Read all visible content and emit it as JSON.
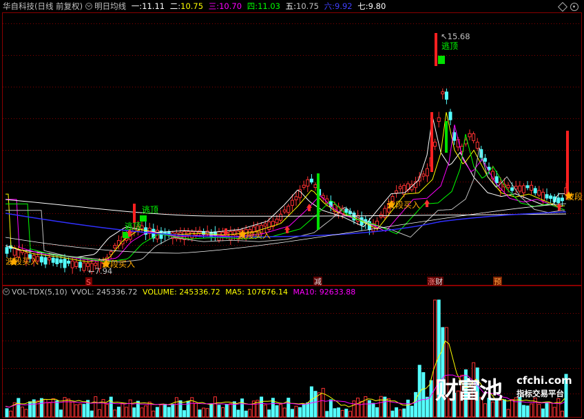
{
  "header": {
    "stock": "华自科技(日线 前复权)",
    "indicator": "明日均线",
    "ma_labels": [
      {
        "label": "一:",
        "value": "11.11",
        "color": "#ffffff"
      },
      {
        "label": "二:",
        "value": "10.75",
        "color": "#ffff00"
      },
      {
        "label": "三:",
        "value": "10.70",
        "color": "#ff00ff"
      },
      {
        "label": "四:",
        "value": "11.03",
        "color": "#00ff00"
      },
      {
        "label": "五:",
        "value": "10.75",
        "color": "#c0c0c0"
      },
      {
        "label": "六:",
        "value": "9.92",
        "color": "#4040ff"
      },
      {
        "label": "七:",
        "value": "9.80",
        "color": "#ffffff"
      }
    ]
  },
  "price_panel": {
    "annotations": {
      "high": "15.68",
      "low": "7.94",
      "escape1": "逃顶",
      "escape2": "逃顶",
      "escape3": "逃顶",
      "buy1": "波段买入",
      "buy2": "波段买入",
      "buy3": "波段买入",
      "buy4": "波段买入",
      "buy5": "波段",
      "tag_s": "S",
      "tag_reduce": "减",
      "tag_finance": "财",
      "tag_zhang": "涨",
      "tag_forecast": "预"
    }
  },
  "volume_panel": {
    "name": "VOL-TDX(5,10)",
    "vvol": "VVOL: 245336.72",
    "volume": "VOLUME: 245336.72",
    "ma5": "MA5: 107676.14",
    "ma10": "MA10: 92633.88",
    "colors": {
      "volume": "#ffff00",
      "ma5": "#ffff00",
      "ma10": "#ff00ff"
    }
  },
  "watermark": {
    "brand": "财富池",
    "url": "cfchi.com",
    "tagline": "指标交易平台"
  },
  "colors": {
    "up": "#ff3232",
    "down": "#54ffff",
    "bg": "#000000",
    "grid": "#8b0000"
  }
}
